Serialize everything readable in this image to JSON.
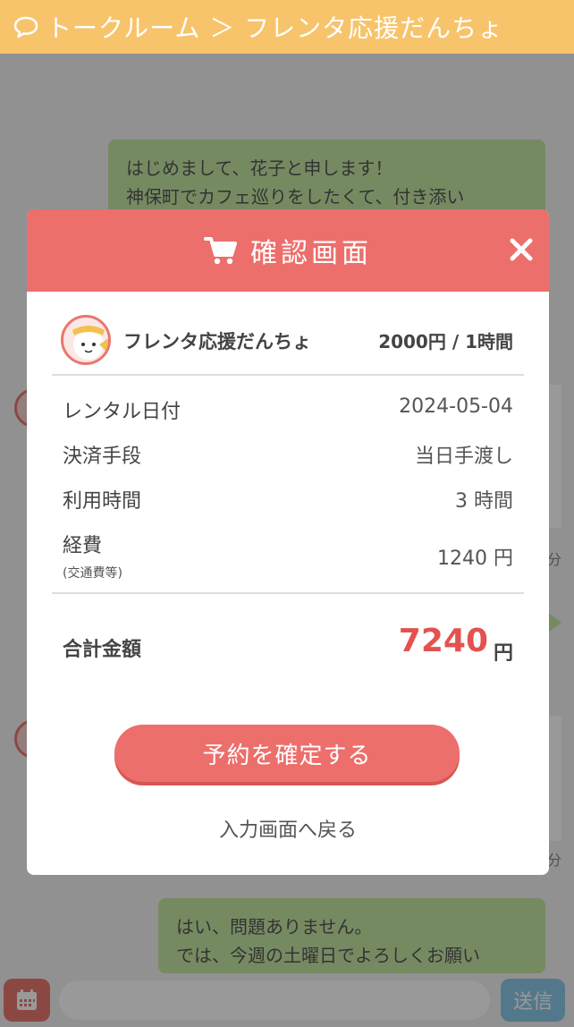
{
  "header": {
    "title": "トークルーム ＞ フレンタ応援だんちょ",
    "icon": "chat-bubble-icon",
    "color": "#f7c46c"
  },
  "chat": {
    "messages": [
      {
        "side": "right",
        "text": "はじめまして、花子と申します！\n神保町でカフェ巡りをしたくて、付き添い"
      },
      {
        "side": "right",
        "text": "はい、問題ありません。\nでは、今週の土曜日でよろしくお願い"
      }
    ],
    "time_suffix_1": "分",
    "time_suffix_2": "分"
  },
  "modal": {
    "title": "確認画面",
    "header_color": "#ec6f6c",
    "provider": {
      "name": "フレンタ応援だんちょ",
      "price": "2000円 / 1時間"
    },
    "details": [
      {
        "label": "レンタル日付",
        "value": "2024-05-04"
      },
      {
        "label": "決済手段",
        "value": "当日手渡し"
      },
      {
        "label": "利用時間",
        "value": "3 時間"
      }
    ],
    "fee": {
      "label": "経費",
      "sub_label": "(交通費等)",
      "value": "1240 円"
    },
    "total": {
      "label": "合計金額",
      "value": "7240",
      "unit": "円",
      "color": "#e3524f"
    },
    "confirm_label": "予約を確定する",
    "back_label": "入力画面へ戻る"
  },
  "input_bar": {
    "placeholder": "",
    "send_label": "送信"
  }
}
